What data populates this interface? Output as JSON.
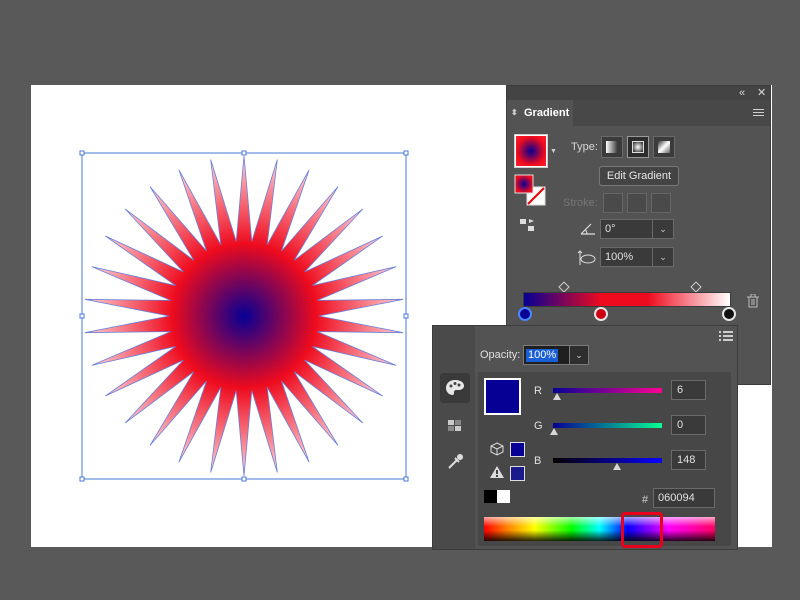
{
  "gradient_panel": {
    "collapse_glyph": "«",
    "close_glyph": "✕",
    "tab_title": "Gradient",
    "type_label": "Type:",
    "edit_button": "Edit Gradient",
    "stroke_label": "Stroke:",
    "angle_value": "0°",
    "aspect_value": "100%"
  },
  "color_panel": {
    "opacity_label": "Opacity:",
    "opacity_value": "100%",
    "r_label": "R",
    "g_label": "G",
    "b_label": "B",
    "r_value": "6",
    "g_value": "0",
    "b_value": "148",
    "hex_prefix": "#",
    "hex_value": "060094",
    "sidebar_icons": [
      "palette-icon",
      "swatches-icon",
      "eyedropper-icon"
    ]
  },
  "colors": {
    "gradient_start": "#060094",
    "gradient_end": "#ee0b1e",
    "selection_blue": "#4a86ff",
    "highlight_red": "#e8001d"
  },
  "artwork": {
    "shape": "star-burst",
    "points": 30,
    "fill": "radial-gradient"
  }
}
